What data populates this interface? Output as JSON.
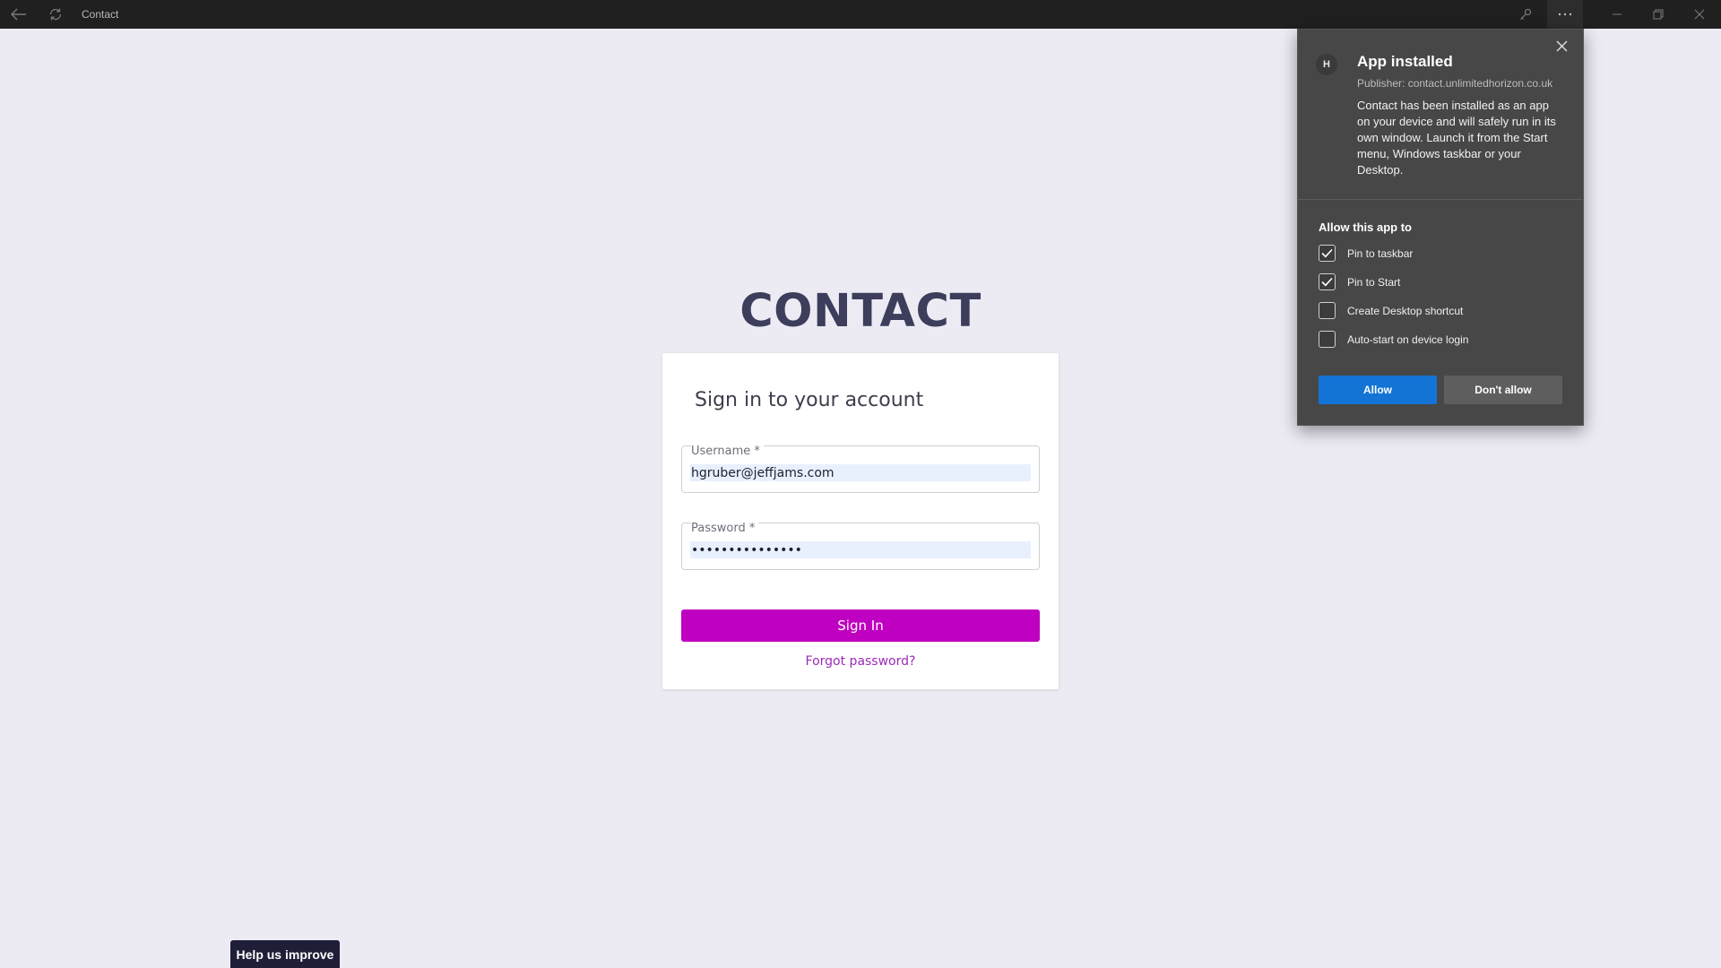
{
  "titlebar": {
    "title": "Contact",
    "icons": [
      "back-arrow-icon",
      "refresh-icon",
      "key-icon",
      "more-icon",
      "minimize-icon",
      "maximize-icon",
      "close-icon"
    ]
  },
  "login": {
    "brand": "CONTACT",
    "heading": "Sign in to your account",
    "username_label": "Username  *",
    "username_value": "hgruber@jeffjams.com",
    "password_label": "Password  *",
    "password_value": "•••••••••••••••",
    "signin_label": "Sign In",
    "forgot_label": "Forgot password?",
    "accent_color": "#c000c0"
  },
  "help_tab": {
    "label": "Help us improve"
  },
  "flyout": {
    "avatar_letter": "H",
    "title": "App installed",
    "publisher": "Publisher: contact.unlimitedhorizon.co.uk",
    "description": "Contact has been installed as an app on your device and will safely run in its own window. Launch it from the Start menu, Windows taskbar or your Desktop.",
    "allow_heading": "Allow this app to",
    "options": [
      {
        "label": "Pin to taskbar",
        "checked": true
      },
      {
        "label": "Pin to Start",
        "checked": true
      },
      {
        "label": "Create Desktop shortcut",
        "checked": false
      },
      {
        "label": "Auto-start on device login",
        "checked": false
      }
    ],
    "allow_label": "Allow",
    "deny_label": "Don't allow",
    "allow_color": "#1474d6"
  }
}
